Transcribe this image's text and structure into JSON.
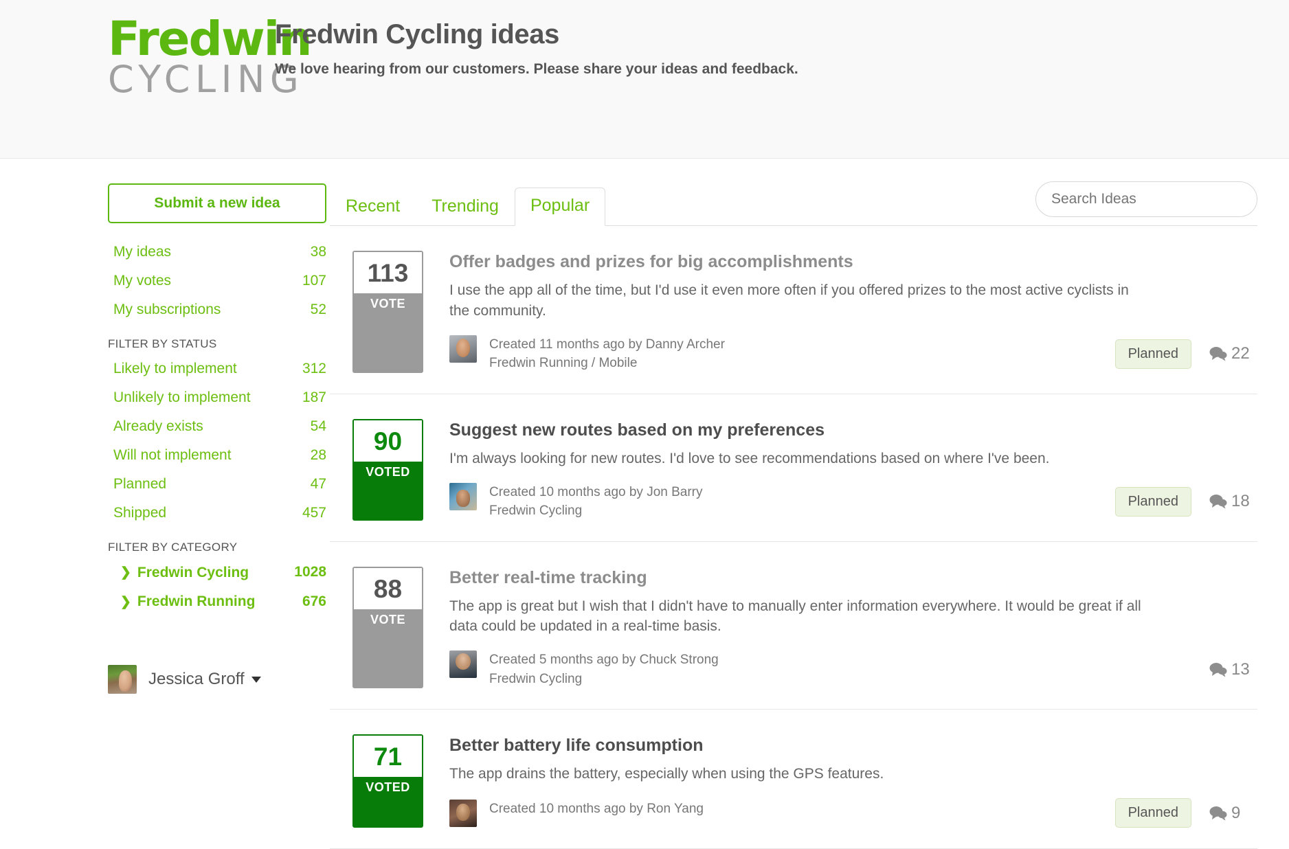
{
  "brand": {
    "logo_top": "Fredwin",
    "logo_bottom": "CYCLING",
    "accent_green": "#5cb811",
    "link_green": "#6cbe10",
    "voted_green": "#087c09",
    "gray": "#9b9b9b"
  },
  "header": {
    "title": "Fredwin Cycling ideas",
    "subtitle": "We love hearing from our customers. Please share your ideas and feedback."
  },
  "sidebar": {
    "submit_label": "Submit a new idea",
    "my_links": [
      {
        "label": "My ideas",
        "count": "38"
      },
      {
        "label": "My votes",
        "count": "107"
      },
      {
        "label": "My subscriptions",
        "count": "52"
      }
    ],
    "status_section_title": "FILTER BY STATUS",
    "statuses": [
      {
        "label": "Likely to implement",
        "count": "312"
      },
      {
        "label": "Unlikely to implement",
        "count": "187"
      },
      {
        "label": "Already exists",
        "count": "54"
      },
      {
        "label": "Will not implement",
        "count": "28"
      },
      {
        "label": "Planned",
        "count": "47"
      },
      {
        "label": "Shipped",
        "count": "457"
      }
    ],
    "category_section_title": "FILTER BY CATEGORY",
    "categories": [
      {
        "label": "Fredwin Cycling",
        "count": "1028",
        "icon": "chevron-right-icon"
      },
      {
        "label": "Fredwin Running",
        "count": "676",
        "icon": "chevron-right-icon"
      }
    ],
    "user": {
      "name": "Jessica Groff",
      "avatar": "user-avatar",
      "caret": "caret-down-icon"
    }
  },
  "main": {
    "tabs": [
      {
        "label": "Recent",
        "active": false
      },
      {
        "label": "Trending",
        "active": false
      },
      {
        "label": "Popular",
        "active": true
      }
    ],
    "search": {
      "placeholder": "Search Ideas",
      "value": "",
      "icon": "search-input"
    },
    "ideas": [
      {
        "votes": "113",
        "vote_label": "VOTE",
        "voted": false,
        "title": "Offer badges and prizes for big accomplishments",
        "title_visited": true,
        "description": "I use the app all of the time, but I'd use it even more often if you offered prizes to the most active cyclists in the community.",
        "created": "Created 11 months ago by Danny Archer",
        "category": "Fredwin Running / Mobile",
        "status": "Planned",
        "comments": "22"
      },
      {
        "votes": "90",
        "vote_label": "VOTED",
        "voted": true,
        "title": "Suggest new routes based on my preferences",
        "title_visited": false,
        "description": "I'm always looking for new routes. I'd love to see recommendations based on where I've been.",
        "created": "Created 10 months ago by Jon Barry",
        "category": "Fredwin Cycling",
        "status": "Planned",
        "comments": "18"
      },
      {
        "votes": "88",
        "vote_label": "VOTE",
        "voted": false,
        "title": "Better real-time tracking",
        "title_visited": true,
        "description": "The app is great but I wish that I didn't have to manually enter information everywhere. It would be great if all data could be updated in a real-time basis.",
        "created": "Created 5 months ago by Chuck Strong",
        "category": "Fredwin Cycling",
        "status": "",
        "comments": "13"
      },
      {
        "votes": "71",
        "vote_label": "VOTED",
        "voted": true,
        "title": "Better battery life consumption",
        "title_visited": false,
        "description": "The app drains the battery, especially when using the GPS features.",
        "created": "Created 10 months ago by Ron Yang",
        "category": "",
        "status": "Planned",
        "comments": "9"
      }
    ]
  }
}
